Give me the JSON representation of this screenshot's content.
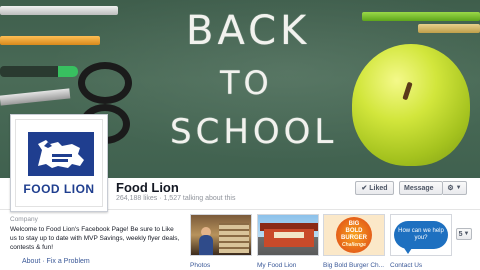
{
  "cover": {
    "chalk_lines": [
      "BACK",
      "TO",
      "SCHOOL"
    ]
  },
  "profile": {
    "logo_text": "FOOD LION"
  },
  "page": {
    "name": "Food Lion",
    "stats": "264,188 likes · 1,527 talking about this"
  },
  "actions": {
    "liked_label": "Liked",
    "liked_icon": "check-icon",
    "message_label": "Message",
    "gear_icon": "gear-icon"
  },
  "about": {
    "heading": "Company",
    "text": "Welcome to Food Lion's Facebook Page! Be sure to Like us to stay up to date with MVP Savings, weekly flyer deals, contests & fun!",
    "link_about": "About",
    "separator": "·",
    "link_report": "Fix a Problem"
  },
  "apps": [
    {
      "label": "Photos"
    },
    {
      "label": "My Food Lion"
    },
    {
      "label": "Big Bold Burger Ch..."
    },
    {
      "label": "Contact Us"
    }
  ],
  "app_art": {
    "bbbc_line1": "BIG",
    "bbbc_line2": "BOLD",
    "bbbc_line3": "BURGER",
    "bbbc_line4": "Challenge",
    "contact_bubble": "How can we help you?"
  },
  "more_apps_count": "5",
  "colors": {
    "link": "#3b5998",
    "brand_blue": "#1f3e8f",
    "chalkboard": "#4a6b57",
    "apple": "#d2e63c"
  }
}
